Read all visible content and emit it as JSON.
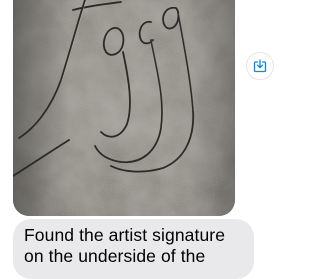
{
  "thread": {
    "messages": [
      {
        "type": "image",
        "subject": "photo of handwritten artist signature scratched into grey stone surface"
      },
      {
        "type": "text",
        "text": "Found the artist signature on the underside of the"
      }
    ],
    "save_button": {
      "icon": "save-download-icon",
      "accent": "#0a84ff"
    }
  }
}
